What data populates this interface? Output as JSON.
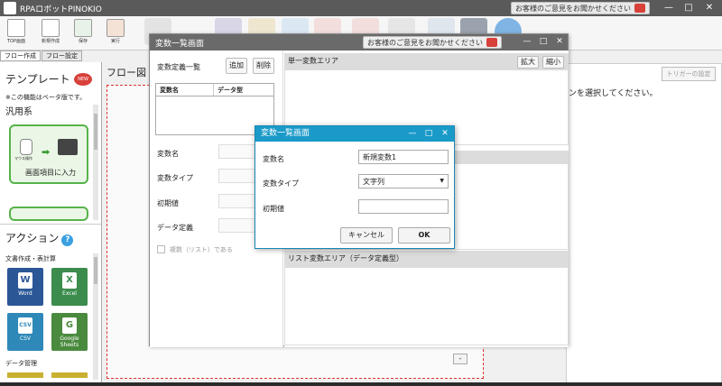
{
  "app": {
    "title": "RPAロボットPINOKIO",
    "feedback_label": "お客様のご意見をお聞かせください",
    "minimize": "—",
    "maximize": "□",
    "close": "✕"
  },
  "toolbar": {
    "buttons": [
      {
        "label": "TOP画面"
      },
      {
        "label": "新規作成"
      },
      {
        "label": "保存"
      },
      {
        "label": "実行"
      }
    ]
  },
  "tabs": [
    {
      "label": "フロー作成"
    },
    {
      "label": "フロー設定"
    }
  ],
  "left_panel": {
    "template_heading": "テンプレート",
    "badge": "NEW",
    "beta_note": "※この機能はベータ版です。",
    "category": "汎用系",
    "template_card_label": "画面項目に入力",
    "template_card_sub": "マウス操作",
    "action_heading": "アクション",
    "help": "?",
    "doc_section": "文書作成・表計算",
    "actions": [
      {
        "name": "Word",
        "glyph": "W",
        "color": "#2b5797"
      },
      {
        "name": "Excel",
        "glyph": "X",
        "color": "#3c8c4e"
      },
      {
        "name": "CSV",
        "glyph": "CSV",
        "color": "#2e88b8"
      },
      {
        "name": "Google Sheets",
        "glyph": "G",
        "color": "#4a8a3e"
      }
    ],
    "data_section": "データ管理"
  },
  "flow": {
    "label": "フロー図",
    "collapse": "-"
  },
  "right_panel": {
    "trigger_button": "トリガーの設定",
    "message": "ンを選択してください。"
  },
  "var_window": {
    "title": "変数一覧画面",
    "feedback_label": "お客様のご意見をお聞かせください",
    "list_title": "変数定義一覧",
    "add": "追加",
    "delete": "削除",
    "columns": [
      "変数名",
      "データ型"
    ],
    "field_name": "変数名",
    "field_type": "変数タイプ",
    "field_init": "初期値",
    "field_datadef": "データ定義",
    "multi_checkbox": "複数（リスト）である",
    "single_area": "単一変数エリア",
    "expand": "拡大",
    "shrink": "縮小",
    "list_area": "リスト変数エリア（データ定義型）"
  },
  "dialog": {
    "title": "変数一覧画面",
    "name_label": "変数名",
    "name_value": "新規変数1",
    "type_label": "変数タイプ",
    "type_value": "文字列",
    "init_label": "初期値",
    "init_value": "",
    "cancel": "キャンセル",
    "ok": "OK"
  }
}
